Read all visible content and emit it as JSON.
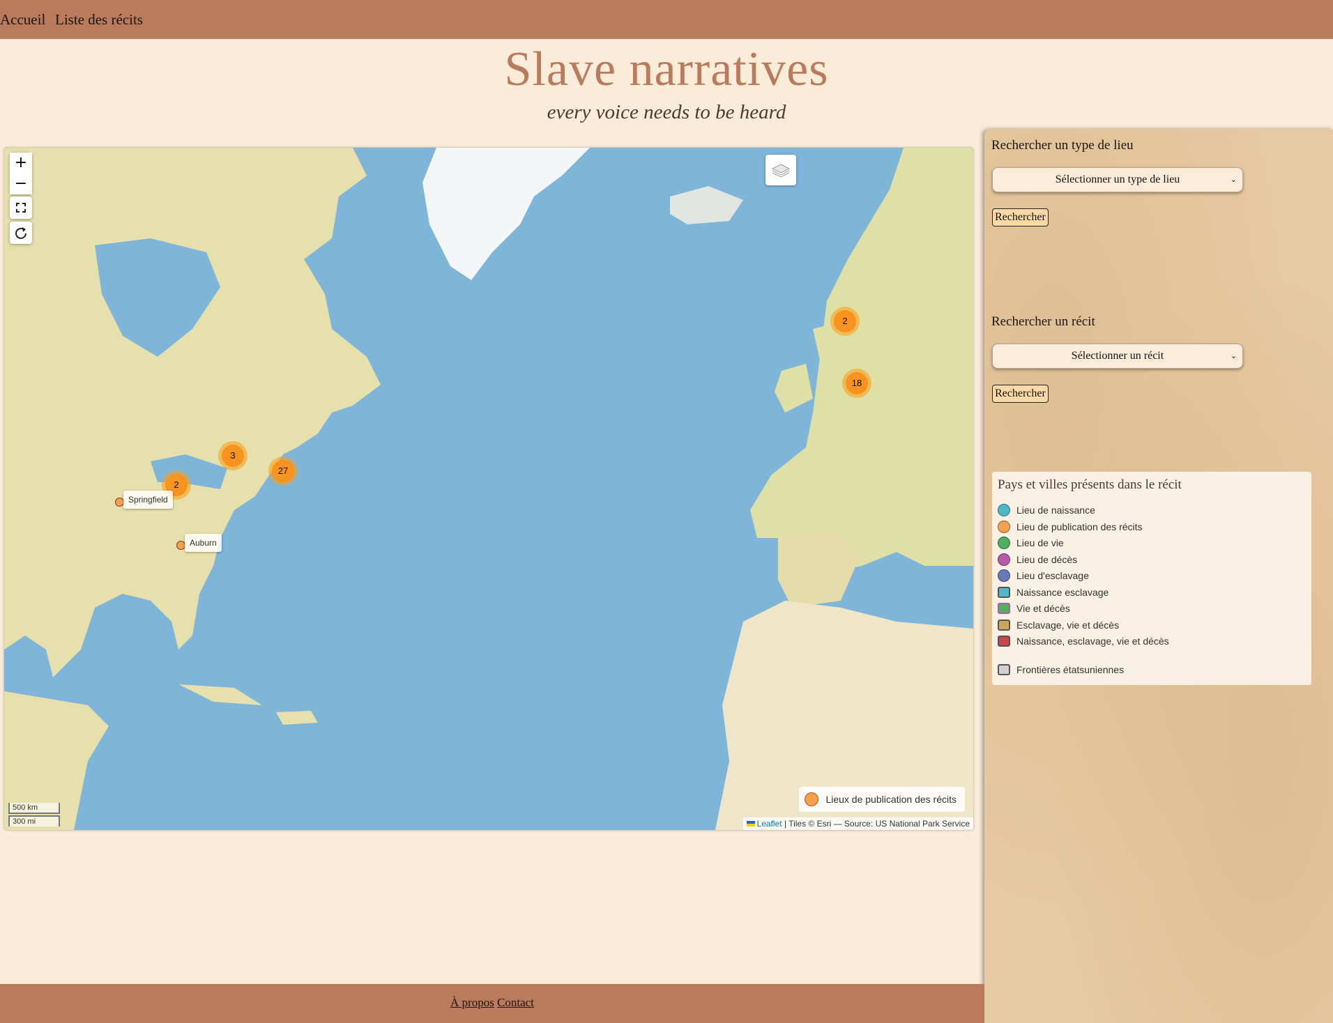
{
  "nav": {
    "home": "Accueil",
    "list": "Liste des récits"
  },
  "header": {
    "title": "Slave narratives",
    "subtitle": "every voice needs to be heard"
  },
  "map": {
    "zoom_in": "+",
    "zoom_out": "−",
    "fullscreen_icon": "fullscreen-icon",
    "reset_icon": "reset-view-icon",
    "layers_icon": "layers-icon",
    "clusters": [
      {
        "id": "scotland",
        "count": "2"
      },
      {
        "id": "england",
        "count": "18"
      },
      {
        "id": "great-lakes",
        "count": "3"
      },
      {
        "id": "new-york",
        "count": "27"
      },
      {
        "id": "ohio",
        "count": "2"
      }
    ],
    "points": [
      {
        "label": "Springfield"
      },
      {
        "label": "Auburn"
      }
    ],
    "legend_label": "Lieux de publication des récits",
    "scale_km": "500 km",
    "scale_mi": "300 mi",
    "attribution_leaflet": "Leaflet",
    "attribution_rest": "| Tiles © Esri — Source: US National Park Service",
    "colors": {
      "ocean": "#7fb5d9",
      "land": "#e8e3b0",
      "marker": "#f7931e"
    }
  },
  "sidebar": {
    "place_type": {
      "heading": "Rechercher un type de lieu",
      "select_value": "Sélectionner un type de lieu",
      "button": "Rechercher"
    },
    "narrative": {
      "heading": "Rechercher un récit",
      "select_value": "Sélectionner un récit",
      "button": "Rechercher"
    },
    "legend": {
      "title": "Pays et villes présents dans le récit",
      "items": [
        {
          "label": "Lieu de naissance",
          "shape": "circle",
          "color": "#4fb8c8"
        },
        {
          "label": "Lieu de publication des récits",
          "shape": "circle",
          "color": "#f5a050"
        },
        {
          "label": "Lieu de vie",
          "shape": "circle",
          "color": "#4fb05f"
        },
        {
          "label": "Lieu de décès",
          "shape": "circle",
          "color": "#b45aa8"
        },
        {
          "label": "Lieu d'esclavage",
          "shape": "circle",
          "color": "#6a78b8"
        },
        {
          "label": "Naissance esclavage",
          "shape": "square",
          "color": "#4fb8c8"
        },
        {
          "label": "Vie et décès",
          "shape": "square",
          "color": "#4fb05f"
        },
        {
          "label": "Esclavage, vie et décès",
          "shape": "square",
          "color": "#c8a858"
        },
        {
          "label": "Naissance, esclavage, vie et décès",
          "shape": "square",
          "color": "#c84848"
        },
        {
          "label": "Frontières étatsuniennes",
          "shape": "square",
          "color": "#cfcfcf"
        }
      ]
    }
  },
  "footer": {
    "about": "À propos",
    "contact": "Contact"
  }
}
